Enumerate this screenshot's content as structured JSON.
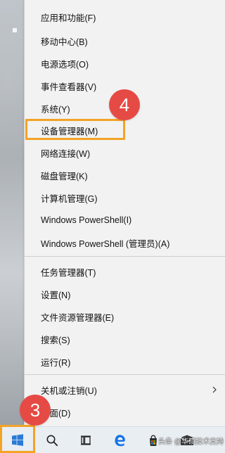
{
  "menu": {
    "items": [
      {
        "label": "应用和功能(F)"
      },
      {
        "label": "移动中心(B)"
      },
      {
        "label": "电源选项(O)"
      },
      {
        "label": "事件查看器(V)"
      },
      {
        "label": "系统(Y)"
      },
      {
        "label": "设备管理器(M)"
      },
      {
        "label": "网络连接(W)"
      },
      {
        "label": "磁盘管理(K)"
      },
      {
        "label": "计算机管理(G)"
      },
      {
        "label": "Windows PowerShell(I)"
      },
      {
        "label": "Windows PowerShell (管理员)(A)"
      },
      {
        "label": "任务管理器(T)"
      },
      {
        "label": "设置(N)"
      },
      {
        "label": "文件资源管理器(E)"
      },
      {
        "label": "搜索(S)"
      },
      {
        "label": "运行(R)"
      },
      {
        "label": "关机或注销(U)"
      },
      {
        "label": "桌面(D)"
      }
    ]
  },
  "badges": {
    "step4": "4",
    "step3": "3"
  },
  "colors": {
    "highlight": "#f4a326",
    "badge": "#e64a45",
    "edge_blue": "#1473e6"
  },
  "taskbar": {
    "buttons": [
      {
        "icon": "windows-logo-icon"
      },
      {
        "icon": "search-icon"
      },
      {
        "icon": "task-view-icon"
      },
      {
        "icon": "edge-icon"
      },
      {
        "icon": "store-bag-icon"
      },
      {
        "icon": "mail-icon"
      }
    ]
  },
  "watermark": "头条 @华硕技术支持"
}
